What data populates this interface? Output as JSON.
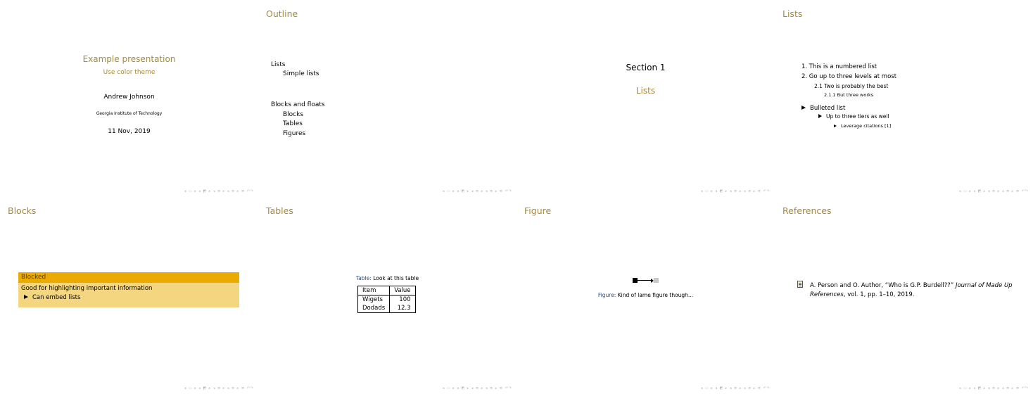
{
  "nav_glyphs": "◂ ▭ ▸ ◂ ◩ ▸ ◂ ≣ ▸ ◂ ≣ ▸   ≣   ↶↷",
  "title_slide": {
    "title": "Example presentation",
    "subtitle": "Use color theme",
    "author": "Andrew Johnson",
    "institute": "Georgia Institute of Technology",
    "date": "11 Nov, 2019"
  },
  "outline_slide": {
    "title": "Outline",
    "items": [
      {
        "label": "Lists"
      },
      {
        "label": "Simple lists"
      },
      {
        "label": "Blocks and floats"
      },
      {
        "label": "Blocks"
      },
      {
        "label": "Tables"
      },
      {
        "label": "Figures"
      }
    ]
  },
  "section_slide": {
    "section_label": "Section 1",
    "section_name": "Lists"
  },
  "lists_slide": {
    "title": "Lists",
    "numbered": [
      "1.  This is a numbered list",
      "2.  Go up to three levels at most",
      "2.1  Two is probably the best",
      "2.1.1  But three works"
    ],
    "bulleted": [
      "Bulleted list",
      "Up to three tiers as well",
      "Leverage citations [1]"
    ]
  },
  "blocks_slide": {
    "title": "Blocks",
    "block_title": "Blocked",
    "block_text": "Good for highlighting important information",
    "block_item": "Can embed lists"
  },
  "tables_slide": {
    "title": "Tables",
    "caption_label": "Table:",
    "caption_text": "Look at this table",
    "header": [
      "Item",
      "Value"
    ],
    "rows": [
      [
        "Wigets",
        "100"
      ],
      [
        "Dodads",
        "12.3"
      ]
    ]
  },
  "figure_slide": {
    "title": "Figure",
    "caption_label": "Figure:",
    "caption_text": "Kind of lame figure though..."
  },
  "references_slide": {
    "title": "References",
    "reference_plain": "A. Person and O. Author, “Who is G.P. Burdell??”",
    "reference_journal": "Journal of Made Up References",
    "reference_tail": ", vol. 1, pp. 1–10, 2019."
  }
}
